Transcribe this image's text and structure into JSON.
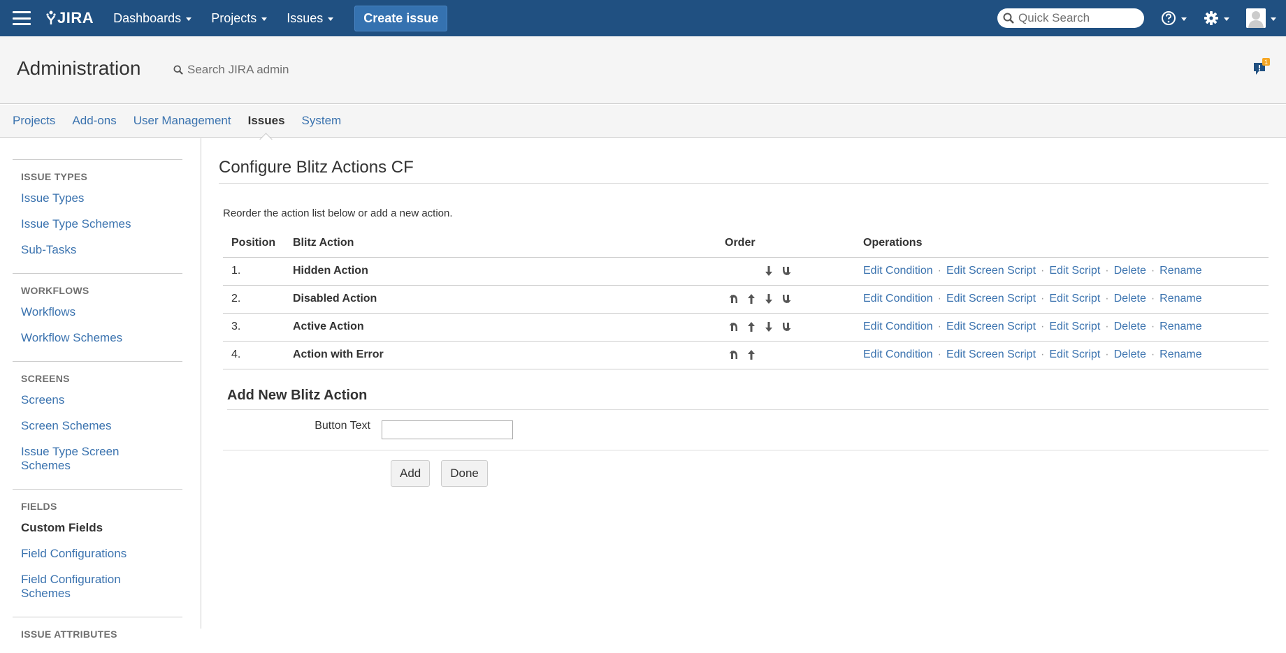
{
  "topbar": {
    "logo": "JIRA",
    "nav": [
      "Dashboards",
      "Projects",
      "Issues"
    ],
    "create_label": "Create issue",
    "quick_search_placeholder": "Quick Search"
  },
  "admin": {
    "title": "Administration",
    "search_placeholder": "Search JIRA admin",
    "feedback_badge": "1"
  },
  "tabs": [
    "Projects",
    "Add-ons",
    "User Management",
    "Issues",
    "System"
  ],
  "sidebar": {
    "issue_types_heading": "ISSUE TYPES",
    "issue_types": [
      "Issue Types",
      "Issue Type Schemes",
      "Sub-Tasks"
    ],
    "workflows_heading": "WORKFLOWS",
    "workflows": [
      "Workflows",
      "Workflow Schemes"
    ],
    "screens_heading": "SCREENS",
    "screens": [
      "Screens",
      "Screen Schemes",
      "Issue Type Screen Schemes"
    ],
    "fields_heading": "FIELDS",
    "fields": [
      "Custom Fields",
      "Field Configurations",
      "Field Configuration Schemes"
    ],
    "attributes_heading": "ISSUE ATTRIBUTES"
  },
  "main": {
    "title": "Configure Blitz Actions CF",
    "description": "Reorder the action list below or add a new action.",
    "columns": [
      "Position",
      "Blitz Action",
      "Order",
      "Operations"
    ],
    "rows": [
      {
        "position": "1.",
        "name": "Hidden Action"
      },
      {
        "position": "2.",
        "name": "Disabled Action"
      },
      {
        "position": "3.",
        "name": "Active Action"
      },
      {
        "position": "4.",
        "name": "Action with Error"
      }
    ],
    "operations": [
      "Edit Condition",
      "Edit Screen Script",
      "Edit Script",
      "Delete",
      "Rename"
    ],
    "add_heading": "Add New Blitz Action",
    "button_text_label": "Button Text",
    "button_text_value": "",
    "add_label": "Add",
    "done_label": "Done"
  }
}
